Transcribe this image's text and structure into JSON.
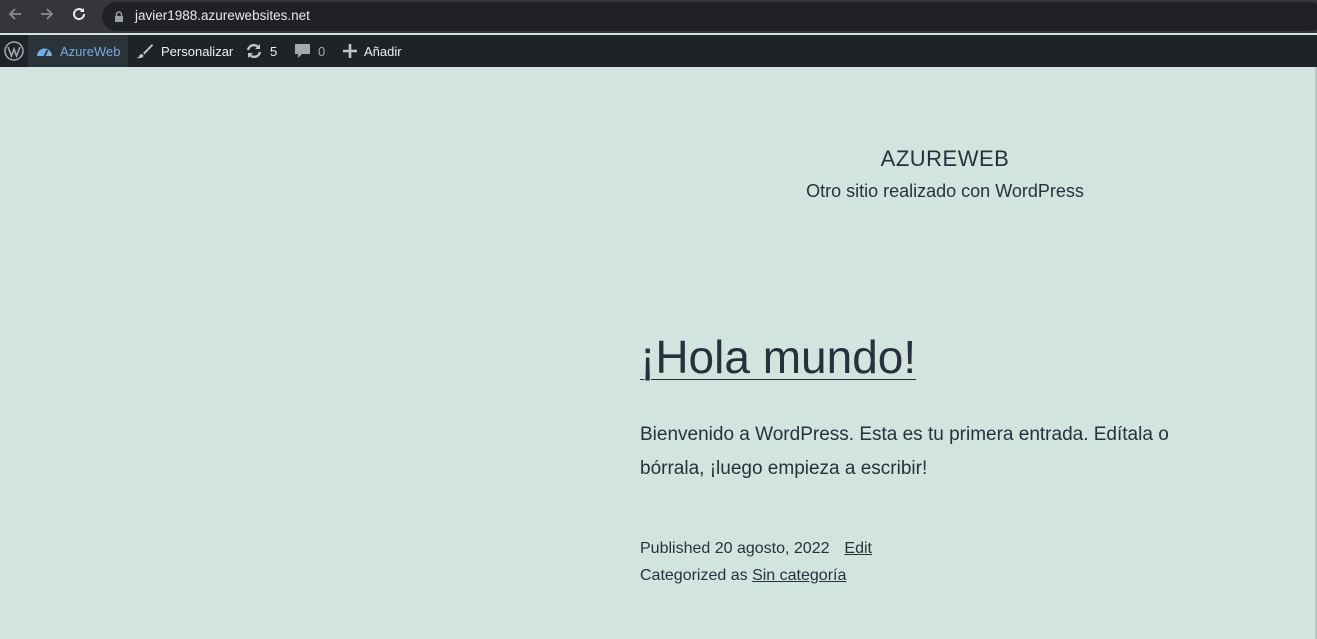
{
  "browser": {
    "url": "javier1988.azurewebsites.net",
    "back_icon": "arrow-left-icon",
    "forward_icon": "arrow-right-icon",
    "reload_icon": "reload-icon",
    "lock_icon": "lock-icon"
  },
  "adminbar": {
    "wp_logo_icon": "wordpress-logo-icon",
    "site_name": "AzureWeb",
    "customize_label": "Personalizar",
    "updates_count": "5",
    "comments_count": "0",
    "new_label": "Añadir"
  },
  "header": {
    "site_title": "AZUREWEB",
    "site_description": "Otro sitio realizado con WordPress"
  },
  "post": {
    "title": "¡Hola mundo!",
    "body": "Bienvenido a WordPress. Esta es tu primera entrada. Edítala o bórrala, ¡luego empieza a escribir!",
    "published_prefix": "Published",
    "published_date": "20 agosto, 2022",
    "edit_label": "Edit",
    "categorized_prefix": "Categorized as",
    "category": "Sin categoría"
  },
  "colors": {
    "background": "#d1e4dd",
    "adminbar": "#1d2327",
    "text": "#28303d",
    "link_active": "#72aee6"
  }
}
